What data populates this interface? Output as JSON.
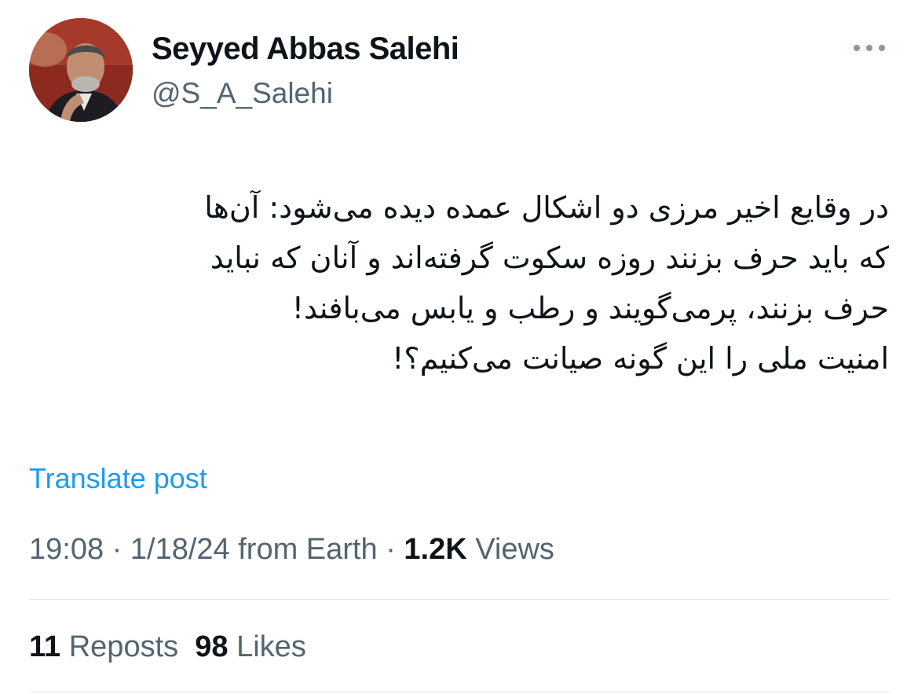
{
  "author": {
    "display_name": "Seyyed Abbas Salehi",
    "handle": "@S_A_Salehi"
  },
  "tweet": {
    "lines": [
      "در وقایع اخیر مرزی دو اشکال عمده دیده می‌شود: آن‌ها",
      "که باید حرف بزنند روزه سکوت گرفته‌اند و آنان که نباید",
      "حرف بزنند، پرمی‌گویند و رطب و یابس می‌بافند!",
      "امنیت ملی را این گونه صیانت می‌کنیم؟!"
    ]
  },
  "translate_label": "Translate post",
  "meta": {
    "time": "19:08",
    "sep1": "·",
    "date": "1/18/24",
    "location": "from Earth",
    "sep2": "·",
    "views_count": "1.2K",
    "views_label": "Views"
  },
  "stats": {
    "reposts_count": "11",
    "reposts_label": "Reposts",
    "likes_count": "98",
    "likes_label": "Likes"
  },
  "icons": {
    "more": "more-horizontal-icon"
  },
  "colors": {
    "text_primary": "#0f1419",
    "text_secondary": "#536471",
    "link": "#1d9bf0",
    "divider": "#e4e8eb"
  }
}
